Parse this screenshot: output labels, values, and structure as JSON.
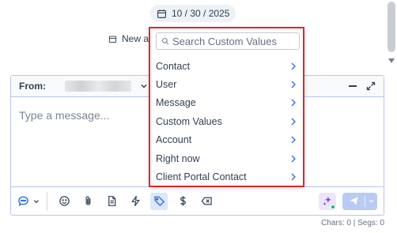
{
  "date_chip": {
    "label": "10 / 30 / 2025",
    "icon": "calendar-icon"
  },
  "new_note": {
    "label": "New a",
    "icon": "calendar-icon"
  },
  "composer": {
    "from_label": "From:",
    "placeholder": "Type a message...",
    "minimize_icon": "minimize-icon",
    "expand_icon": "expand-icon"
  },
  "dropdown": {
    "search_placeholder": "Search Custom Values",
    "items": [
      {
        "label": "Contact"
      },
      {
        "label": "User"
      },
      {
        "label": "Message"
      },
      {
        "label": "Custom Values"
      },
      {
        "label": "Account"
      },
      {
        "label": "Right now"
      },
      {
        "label": "Client Portal Contact"
      }
    ]
  },
  "toolbar": {
    "icons": [
      "chat-channel-icon",
      "emoji-icon",
      "attachment-icon",
      "document-icon",
      "lightning-icon",
      "tag-icon",
      "dollar-icon",
      "clear-icon",
      "ai-sparkle-icon",
      "send-icon"
    ]
  },
  "counts": {
    "label": "Chars: 0 | Segs: 0"
  },
  "colors": {
    "highlight_border": "#e0262b",
    "accent": "#2e6bd8",
    "send_bg": "#b9cbf4",
    "ai_dot": "#12b76a"
  }
}
